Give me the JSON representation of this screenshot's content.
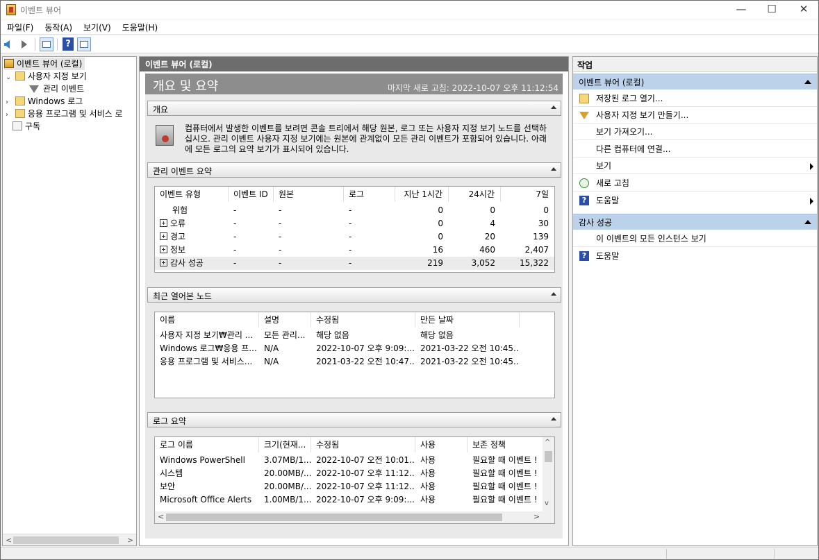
{
  "window": {
    "title": "이벤트 뷰어",
    "controls": {
      "minimize": "—",
      "maximize": "☐",
      "close": "✕"
    }
  },
  "menu": [
    "파일(F)",
    "동작(A)",
    "보기(V)",
    "도움말(H)"
  ],
  "toolbar": {
    "icons": [
      "back-arrow-icon",
      "forward-arrow-icon",
      "show-tree-icon",
      "help-icon",
      "show-actions-icon"
    ],
    "help_glyph": "?"
  },
  "tree": {
    "root": "이벤트 뷰어 (로컬)",
    "custom_views": "사용자 지정 보기",
    "admin_events": "관리 이벤트",
    "windows_logs": "Windows 로그",
    "apps_services": "응용 프로그램 및 서비스 로",
    "subscriptions": "구독",
    "scroll_left": "<",
    "scroll_right": ">"
  },
  "center": {
    "header": "이벤트 뷰어 (로컬)",
    "title": "개요 및 요약",
    "last_refresh": "마지막 새로 고침: 2022-10-07 오후 11:12:54",
    "overview": {
      "title": "개요",
      "description": "컴퓨터에서 발생한 이벤트를 보려면 콘솔 트리에서 해당 원본, 로그 또는 사용자 지정 보기 노드를 선택하십시오. 관리 이벤트 사용자 지정 보기에는 원본에 관계없이 모든 관리 이벤트가 포함되어 있습니다. 아래에 모든 로그의 요약 보기가 표시되어 있습니다."
    },
    "admin_summary": {
      "title": "관리 이벤트 요약",
      "columns": [
        "이벤트 유형",
        "이벤트 ID",
        "원본",
        "로그",
        "지난 1시간",
        "24시간",
        "7일"
      ],
      "rows": [
        {
          "type": "위험",
          "expand": false,
          "id": "-",
          "source": "-",
          "log": "-",
          "h1": "0",
          "h24": "0",
          "d7": "0"
        },
        {
          "type": "오류",
          "expand": true,
          "id": "-",
          "source": "-",
          "log": "-",
          "h1": "0",
          "h24": "4",
          "d7": "30"
        },
        {
          "type": "경고",
          "expand": true,
          "id": "-",
          "source": "-",
          "log": "-",
          "h1": "0",
          "h24": "20",
          "d7": "139"
        },
        {
          "type": "정보",
          "expand": true,
          "id": "-",
          "source": "-",
          "log": "-",
          "h1": "16",
          "h24": "460",
          "d7": "2,407"
        },
        {
          "type": "감사 성공",
          "expand": true,
          "id": "-",
          "source": "-",
          "log": "-",
          "h1": "219",
          "h24": "3,052",
          "d7": "15,322"
        }
      ]
    },
    "recent_nodes": {
      "title": "최근 열어본 노드",
      "columns": [
        "이름",
        "설명",
        "수정됨",
        "만든 날짜"
      ],
      "rows": [
        {
          "name": "사용자 지정 보기₩관리 ...",
          "desc": "모든 관리...",
          "modified": "해당 없음",
          "created": "해당 없음"
        },
        {
          "name": "Windows 로그₩응용 프...",
          "desc": "N/A",
          "modified": "2022-10-07 오후 9:09:...",
          "created": "2021-03-22 오전 10:45..."
        },
        {
          "name": "응용 프로그램 및 서비스...",
          "desc": "N/A",
          "modified": "2021-03-22 오전 10:47...",
          "created": "2021-03-22 오전 10:45..."
        }
      ]
    },
    "log_summary": {
      "title": "로그 요약",
      "columns": [
        "로그 이름",
        "크기(현재...",
        "수정됨",
        "사용",
        "보존 정책"
      ],
      "rows": [
        {
          "name": "Windows PowerShell",
          "size": "3.07MB/1...",
          "modified": "2022-10-07 오전 10:01...",
          "enabled": "사용",
          "policy": "필요할 때 이벤트 !"
        },
        {
          "name": "시스템",
          "size": "20.00MB/...",
          "modified": "2022-10-07 오후 11:12...",
          "enabled": "사용",
          "policy": "필요할 때 이벤트 !"
        },
        {
          "name": "보안",
          "size": "20.00MB/...",
          "modified": "2022-10-07 오후 11:12...",
          "enabled": "사용",
          "policy": "필요할 때 이벤트 !"
        },
        {
          "name": "Microsoft Office Alerts",
          "size": "1.00MB/1...",
          "modified": "2022-10-07 오후 9:09:...",
          "enabled": "사용",
          "policy": "필요할 때 이벤트 !"
        }
      ],
      "scroll": {
        "up": "^",
        "down": "v",
        "left": "<",
        "right": ">"
      }
    }
  },
  "actions": {
    "title": "작업",
    "group1": "이벤트 뷰어 (로컬)",
    "group1_items": [
      "저장된 로그 열기...",
      "사용자 지정 보기 만들기...",
      "보기 가져오기...",
      "다른 컴퓨터에 연결...",
      "보기",
      "새로 고침",
      "도움말"
    ],
    "group2": "감사 성공",
    "group2_items": [
      "이 이벤트의 모든 인스턴스 보기",
      "도움말"
    ],
    "help_glyph": "?"
  }
}
